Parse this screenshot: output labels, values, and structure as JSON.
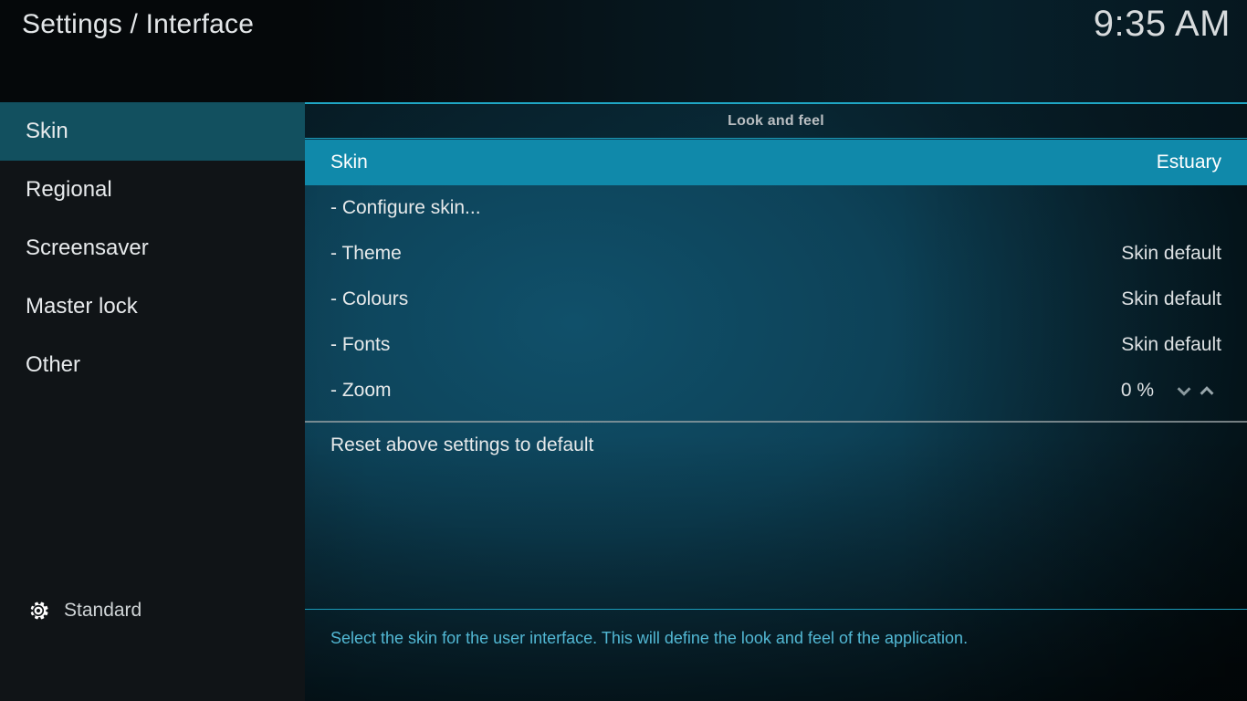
{
  "window": {
    "title": "Settings / Interface",
    "clock": "9:35 AM"
  },
  "colors": {
    "accent": "#1089aa",
    "sidebar_selected": "#12505f",
    "sidebar_bg": "#101417",
    "help_text": "#52b8d4",
    "divider_cyan": "#1a9ab8",
    "separator_gray": "#9aa3a6"
  },
  "sidebar": {
    "items": [
      {
        "label": "Skin",
        "selected": true
      },
      {
        "label": "Regional",
        "selected": false
      },
      {
        "label": "Screensaver",
        "selected": false
      },
      {
        "label": "Master lock",
        "selected": false
      },
      {
        "label": "Other",
        "selected": false
      }
    ],
    "footer": {
      "icon": "gear-icon",
      "label": "Standard"
    }
  },
  "main": {
    "group_header": "Look and feel",
    "rows": [
      {
        "label": "Skin",
        "value": "Estuary",
        "selected": true,
        "spinner": false
      },
      {
        "label": "- Configure skin...",
        "value": "",
        "selected": false,
        "spinner": false
      },
      {
        "label": "- Theme",
        "value": "Skin default",
        "selected": false,
        "spinner": false
      },
      {
        "label": "- Colours",
        "value": "Skin default",
        "selected": false,
        "spinner": false
      },
      {
        "label": "- Fonts",
        "value": "Skin default",
        "selected": false,
        "spinner": false
      },
      {
        "label": "- Zoom",
        "value": "0 %",
        "selected": false,
        "spinner": true
      }
    ],
    "reset_row": {
      "label": "Reset above settings to default"
    },
    "help_text": "Select the skin for the user interface. This will define the look and feel of the application."
  }
}
